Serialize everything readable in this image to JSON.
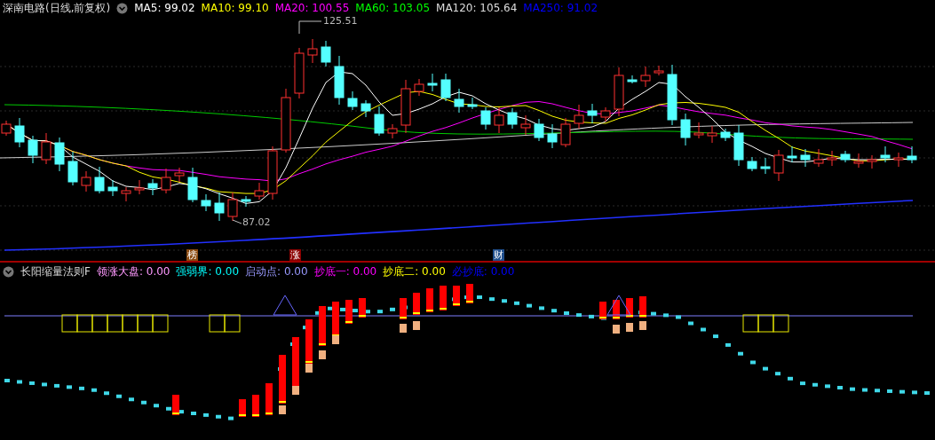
{
  "title": "深南电路(日线,前复权)",
  "ma_legend": [
    {
      "label": "MA5: 99.02",
      "color": "#ffffff"
    },
    {
      "label": "MA10: 99.10",
      "color": "#ffff00"
    },
    {
      "label": "MA20: 100.55",
      "color": "#ff00ff"
    },
    {
      "label": "MA60: 103.05",
      "color": "#00ff00"
    },
    {
      "label": "MA120: 105.64",
      "color": "#dddddd"
    },
    {
      "label": "MA250: 91.02",
      "color": "#0000ff"
    }
  ],
  "price_labels": {
    "high": "125.51",
    "low": "87.02"
  },
  "event_markers": [
    {
      "label": "榜",
      "color": "#8b4a10"
    },
    {
      "label": "涨",
      "color": "#8b0000"
    },
    {
      "label": "财",
      "color": "#1f4e8c"
    }
  ],
  "indicator_title": "长阳缩量法则F",
  "indicator_legend": [
    {
      "label": "领涨大盘: 0.00",
      "color": "#ff99ff"
    },
    {
      "label": "强弱界: 0.00",
      "color": "#00ffff"
    },
    {
      "label": "启动点: 0.00",
      "color": "#9999ff"
    },
    {
      "label": "抄底一: 0.00",
      "color": "#ff00ff"
    },
    {
      "label": "抄底二: 0.00",
      "color": "#ffff00"
    },
    {
      "label": "必抄底: 0.00",
      "color": "#0000ff"
    }
  ]
}
